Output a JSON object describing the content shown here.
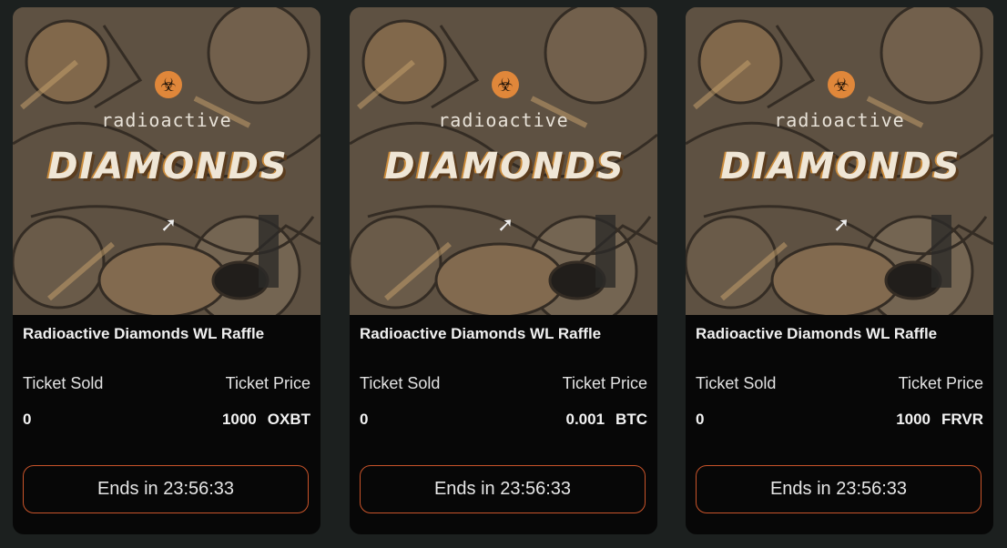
{
  "cards": [
    {
      "title": "Radioactive Diamonds WL Raffle",
      "art_heading": "radioactive",
      "art_logo_text": "DIAMONDS",
      "sold_label": "Ticket Sold",
      "price_label": "Ticket Price",
      "sold_value": "0",
      "price_amount": "1000",
      "price_token": "OXBT",
      "ends_button": "Ends in 23:56:33"
    },
    {
      "title": "Radioactive Diamonds WL Raffle",
      "art_heading": "radioactive",
      "art_logo_text": "DIAMONDS",
      "sold_label": "Ticket Sold",
      "price_label": "Ticket Price",
      "sold_value": "0",
      "price_amount": "0.001",
      "price_token": "BTC",
      "ends_button": "Ends in 23:56:33"
    },
    {
      "title": "Radioactive Diamonds WL Raffle",
      "art_heading": "radioactive",
      "art_logo_text": "DIAMONDS",
      "sold_label": "Ticket Sold",
      "price_label": "Ticket Price",
      "sold_value": "0",
      "price_amount": "1000",
      "price_token": "FRVR",
      "ends_button": "Ends in 23:56:33"
    }
  ],
  "colors": {
    "page_bg": "#1c201f",
    "card_bg": "#070707",
    "accent_border": "#c9542a",
    "badge": "#e0873a"
  },
  "icons": {
    "badge": "biohazard-icon",
    "cursor": "cursor-arrow-icon"
  }
}
